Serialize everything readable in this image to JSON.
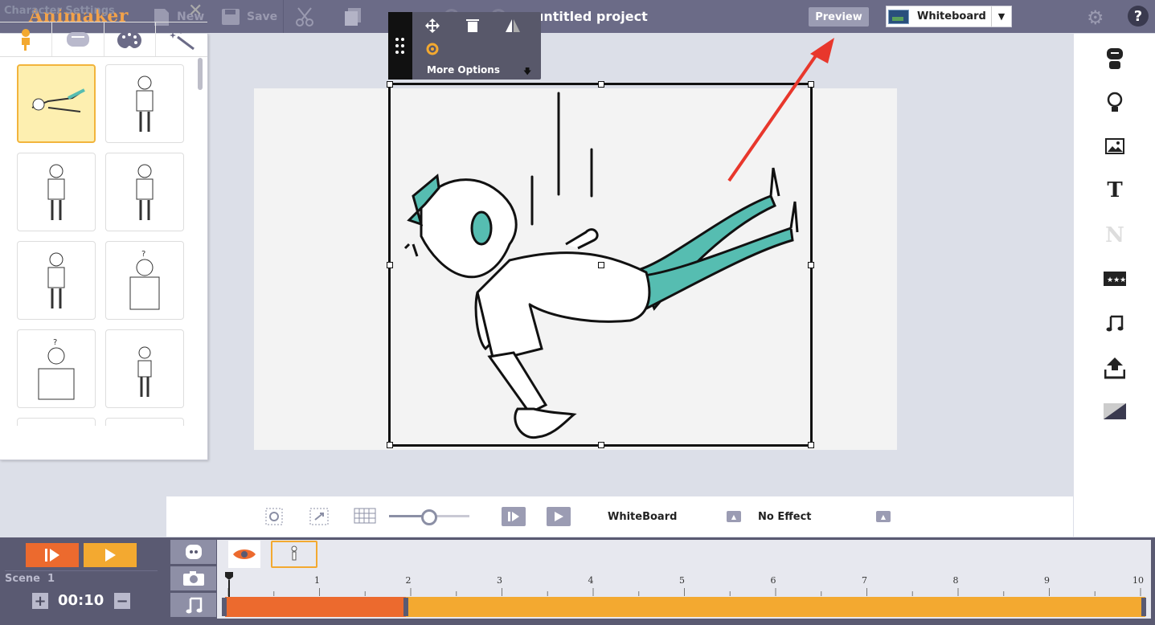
{
  "app": {
    "logo": "Animaker",
    "project_title": "untitled project"
  },
  "toolbar": {
    "new_label": "New",
    "save_label": "Save",
    "preview_label": "Preview",
    "theme_selected": "Whiteboard"
  },
  "floating_toolbar": {
    "more_options_label": "More Options"
  },
  "char_panel": {
    "title": "Character Settings",
    "tabs": [
      "character-icon",
      "face-icon",
      "palette-icon",
      "magic-wand-icon"
    ]
  },
  "controls": {
    "transition_label": "WhiteBoard",
    "effect_label": "No Effect",
    "zoom_level": 0.5
  },
  "timeline": {
    "scene_label": "Scene  1",
    "duration": "00:10",
    "ruler": [
      "1",
      "2",
      "3",
      "4",
      "5",
      "6",
      "7",
      "8",
      "9",
      "10"
    ],
    "bar_split": 0.195
  },
  "colors": {
    "accent_orange": "#ec6a2e",
    "accent_yellow": "#f3a930",
    "topbar": "#6b6b87",
    "arrow": "#e8372c"
  }
}
